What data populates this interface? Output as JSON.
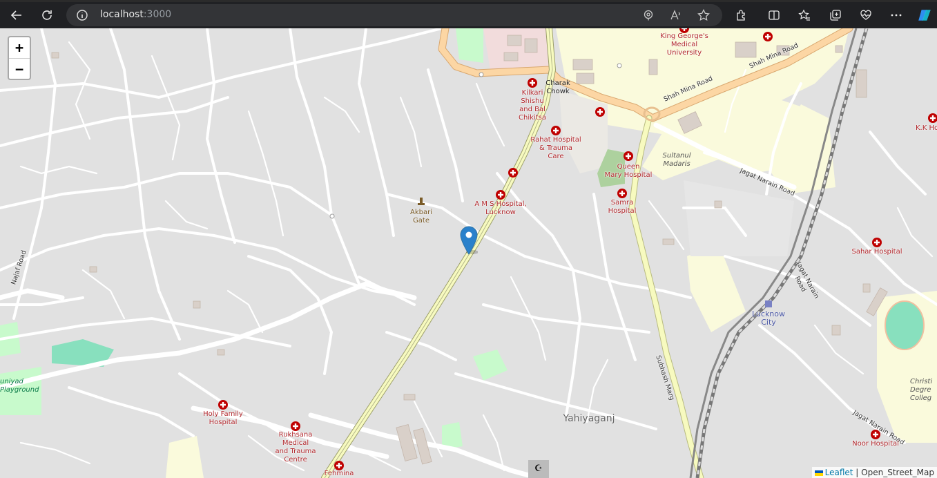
{
  "browser": {
    "url_host": "localhost",
    "url_port": ":3000"
  },
  "map": {
    "zoom_in_label": "+",
    "zoom_out_label": "−",
    "attribution": {
      "leaflet": "Leaflet",
      "separator": " | ",
      "tiles": "Open_Street_Map"
    },
    "labels": {
      "king_georges": "King George's\nMedical\nUniversity",
      "shah_mina_1": "Shah Mina Road",
      "shah_mina_2": "Shah Mina Road",
      "charak_chowk": "Charak\nChowk",
      "kilkari": "Kilkari\nShishu\nand Bal\nChikitsa",
      "rahat": "Rahat Hospital\n& Trauma\nCare",
      "queen_mary": "Queen\nMary Hospital",
      "sultanul": "Sultanul\nMadaris",
      "jagat_narain_1": "Jagat Narain Road",
      "jagat_narain_2": "Jagat Narain\nRoad",
      "jagat_narain_3": "Jagat Narain Road",
      "ams": "A M S Hospital,\nLucknow",
      "samra": "Samra\nHospital",
      "akbari_gate": "Akbari\nGate",
      "kk_ho": "K.K Ho",
      "sahar": "Sahar Hospital",
      "lucknow_city": "Lucknow\nCity",
      "subhash_marg": "Subhash Marg",
      "najaf_road": "Najaf Road",
      "uniyad": "uniyad\nPlayground",
      "holy_family": "Holy Family\nHospital",
      "rukhsana": "Rukhsana\nMedical\nand Trauma\nCentre",
      "fehmina": "Fehmina",
      "yahiyaganj": "Yahiyaganj",
      "christ": "Christi\nDegre\nColleg",
      "noor": "Noor Hospital"
    }
  },
  "colors": {
    "poi_red": "#b1272c",
    "marker_blue": "#2a81cb",
    "road_yellow": "#f7fabf",
    "road_orange": "#fcd6a4"
  }
}
